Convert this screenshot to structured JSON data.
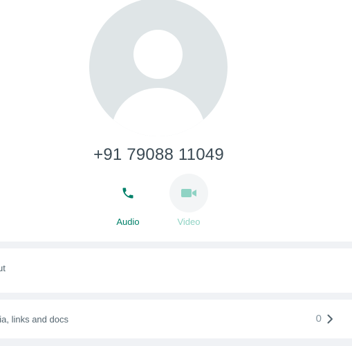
{
  "contact": {
    "phone_number": "+91 79088 11049"
  },
  "call_actions": {
    "audio_label": "Audio",
    "video_label": "Video"
  },
  "about": {
    "label": "ut"
  },
  "media": {
    "label": "dia, links and docs",
    "count": "0"
  },
  "colors": {
    "accent": "#008069",
    "accent_disabled": "#8fd3c4",
    "avatar_bg": "#dfe5e7",
    "panel_bg": "#f0f2f5"
  },
  "icons": {
    "audio": "phone-icon",
    "video": "video-camera-icon",
    "media_chevron": "chevron-right-icon"
  }
}
